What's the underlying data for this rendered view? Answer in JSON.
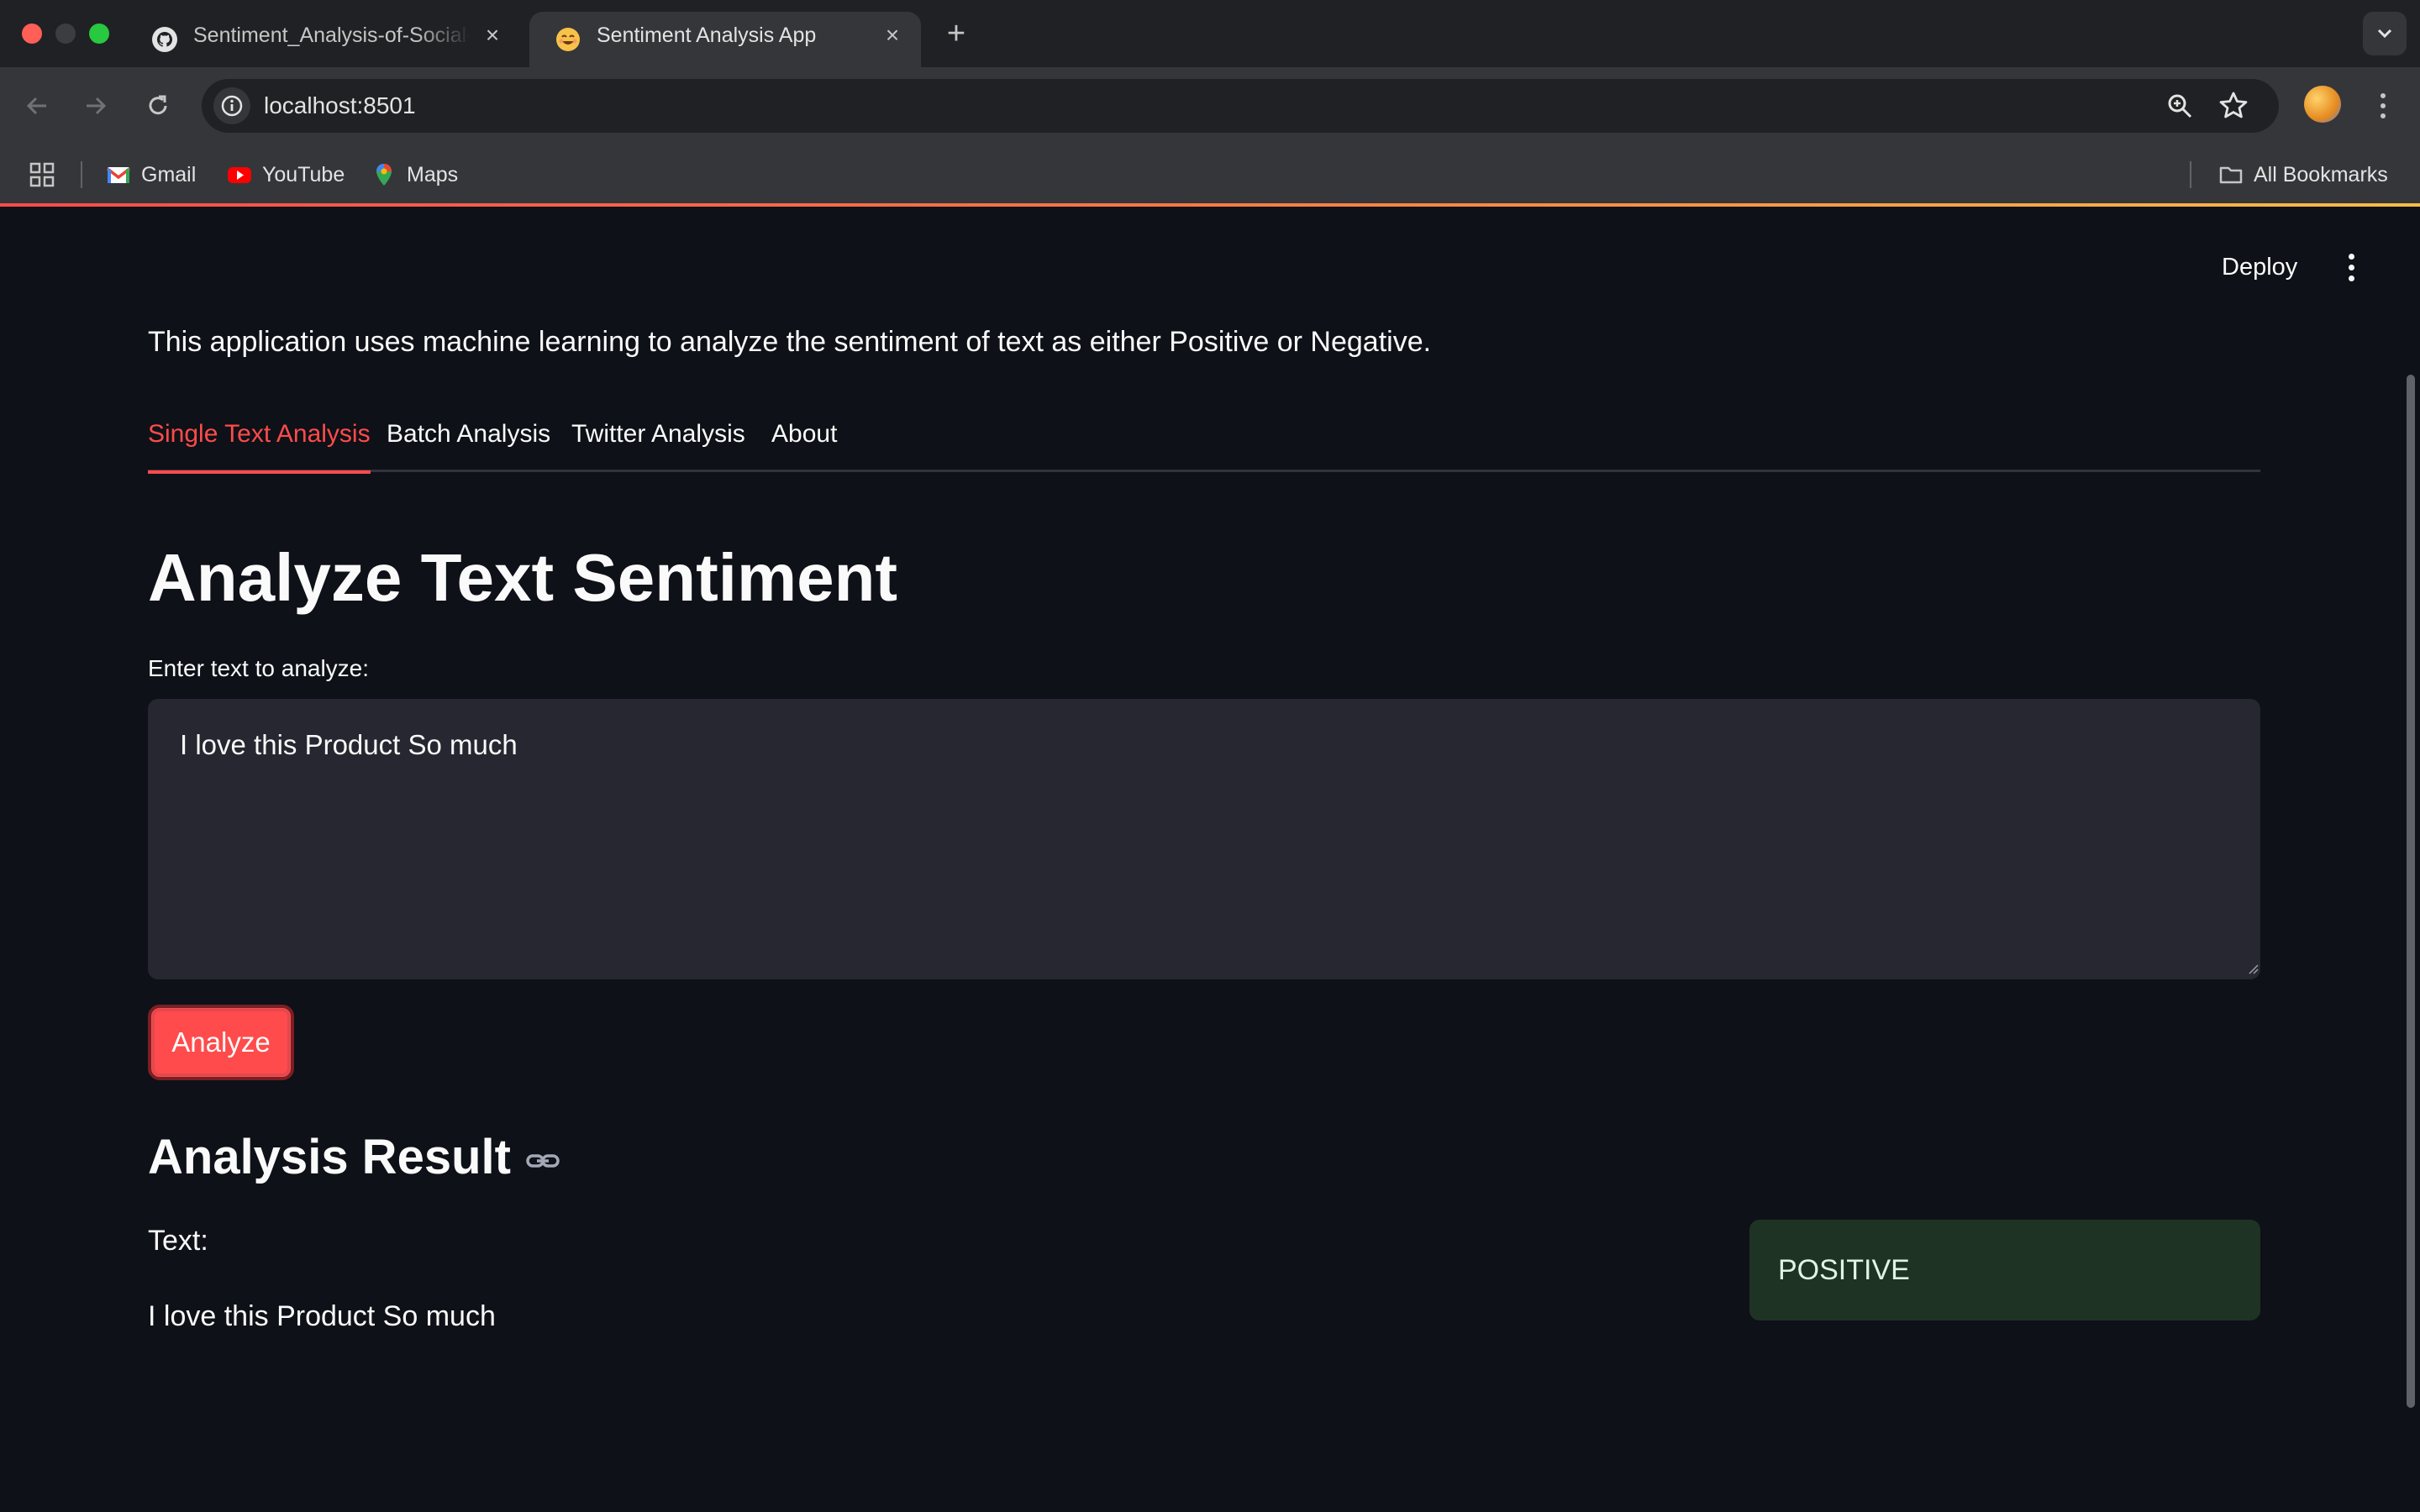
{
  "browser": {
    "tabs": [
      {
        "title": "Sentiment_Analysis-of-Social-Media",
        "icon": "github-icon"
      },
      {
        "title": "Sentiment Analysis App",
        "icon": "smiley-icon"
      }
    ],
    "url": "localhost:8501",
    "bookmarks": [
      {
        "label": "Gmail",
        "icon": "gmail-icon"
      },
      {
        "label": "YouTube",
        "icon": "youtube-icon"
      },
      {
        "label": "Maps",
        "icon": "maps-icon"
      }
    ],
    "all_bookmarks": "All Bookmarks"
  },
  "app": {
    "deploy_label": "Deploy",
    "description": "This application uses machine learning to analyze the sentiment of text as either Positive or Negative.",
    "tabs": [
      "Single Text Analysis",
      "Batch Analysis",
      "Twitter Analysis",
      "About"
    ],
    "active_tab": "Single Text Analysis",
    "heading": "Analyze Text Sentiment",
    "input_label": "Enter text to analyze:",
    "input_value": "I love this Product So much",
    "analyze_button": "Analyze",
    "result_heading": "Analysis Result",
    "text_label": "Text:",
    "text_value": "I love this Product So much",
    "sentiment": "POSITIVE"
  },
  "colors": {
    "accent": "#ff4b4b",
    "background": "#0e1117",
    "success_bg": "#1f3325"
  }
}
